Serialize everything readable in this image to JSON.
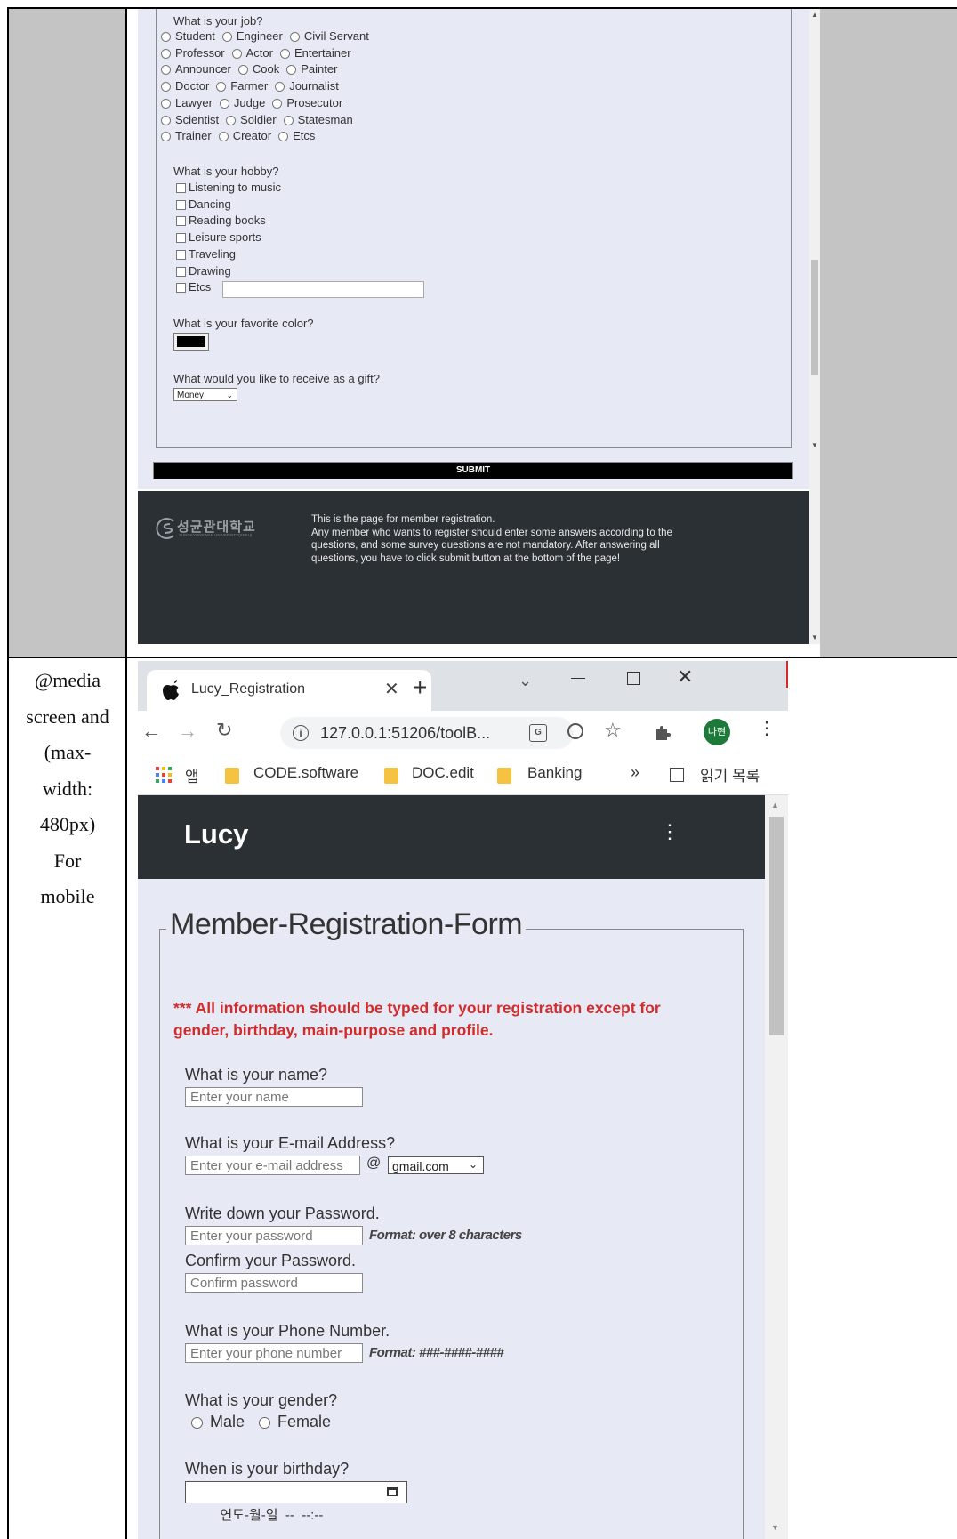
{
  "doc_table": {
    "row2_label": [
      "@media",
      "screen and",
      "(max-",
      "width:",
      "480px)",
      "For",
      "mobile"
    ]
  },
  "upper": {
    "job": {
      "question": "What is your job?",
      "rows": [
        [
          "Student",
          "Engineer",
          "Civil Servant"
        ],
        [
          "Professor",
          "Actor",
          "Entertainer"
        ],
        [
          "Announcer",
          "Cook",
          "Painter"
        ],
        [
          "Doctor",
          "Farmer",
          "Journalist"
        ],
        [
          "Lawyer",
          "Judge",
          "Prosecutor"
        ],
        [
          "Scientist",
          "Soldier",
          "Statesman"
        ],
        [
          "Trainer",
          "Creator",
          "Etcs"
        ]
      ]
    },
    "hobby": {
      "question": "What is your hobby?",
      "items": [
        "Listening to music",
        "Dancing",
        "Reading books",
        "Leisure sports",
        "Traveling",
        "Drawing",
        "Etcs"
      ]
    },
    "color": {
      "question": "What is your favorite color?",
      "value": "#000000"
    },
    "gift": {
      "question": "What would you like to receive as a gift?",
      "selected": "Money"
    },
    "submit_label": "SUBMIT",
    "footer": {
      "logo_text": "성균관대학교",
      "logo_sub": "SUNGKYUNKWAN UNIVERSITY(SKKU)",
      "lines": [
        "This is the page for member registration.",
        "Any member who wants to register should enter some answers according to the",
        "questions, and some survey questions are not mandatory. After answering all",
        "questions, you have to click submit button at the bottom of the page!"
      ]
    }
  },
  "browser": {
    "tab_title": "Lucy_Registration",
    "url": "127.0.0.1:51206/toolB...",
    "profile": "나현",
    "bookmarks": [
      {
        "label": "앱",
        "icon": "apps-grid-icon"
      },
      {
        "label": "CODE.software",
        "icon": "folder-icon"
      },
      {
        "label": "DOC.edit",
        "icon": "folder-icon"
      },
      {
        "label": "Banking",
        "icon": "folder-icon"
      }
    ],
    "overflow": "»",
    "reading_list": "읽기 목록"
  },
  "page": {
    "brand": "Lucy",
    "legend": "Member-Registration-Form",
    "notice_line1": "*** All information should be typed for your registration except for",
    "notice_line2": "gender, birthday, main-purpose and profile.",
    "name": {
      "label": "What is your name?",
      "placeholder": "Enter your name"
    },
    "email": {
      "label": "What is your E-mail Address?",
      "placeholder": "Enter your e-mail address",
      "at": "@",
      "domain": "gmail.com"
    },
    "password": {
      "label": "Write down your Password.",
      "placeholder": "Enter your password",
      "format": "Format: over 8 characters"
    },
    "confirm": {
      "label": "Confirm your Password.",
      "placeholder": "Confirm password"
    },
    "phone": {
      "label": "What is your Phone Number.",
      "placeholder": "Enter your phone number",
      "format": "Format: ###-####-####"
    },
    "gender": {
      "label": "What is your gender?",
      "options": [
        "Male",
        "Female"
      ]
    },
    "birthday": {
      "label": "When is your birthday?",
      "value": "연도-월-일  --  --:--"
    }
  },
  "colors": {
    "nav_bg": "#2b3035",
    "form_bg": "#e7e9f5",
    "notice_red": "#d22b2b",
    "profile_green": "#1e7a3a"
  }
}
